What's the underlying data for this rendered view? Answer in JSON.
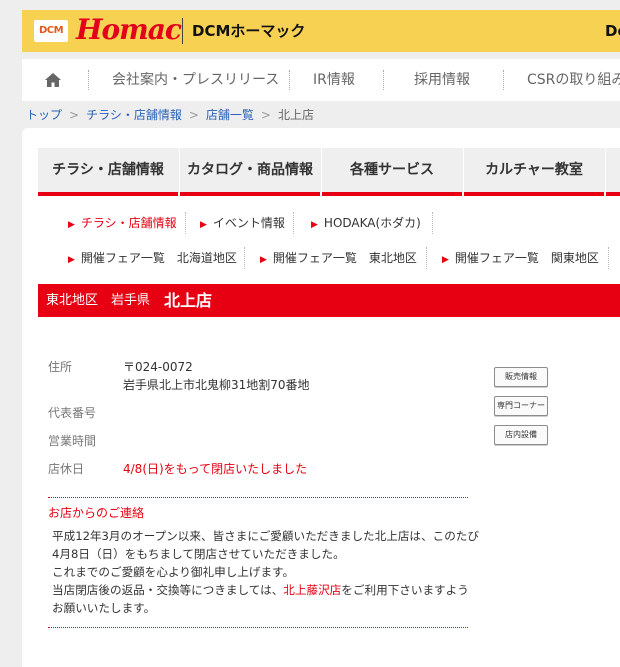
{
  "header": {
    "dcm_badge": "DCM",
    "brand": "Homac",
    "company": "DCMホーマック",
    "right_cut": "De"
  },
  "topnav": {
    "items": [
      "会社案内・プレスリリース",
      "IR情報",
      "採用情報",
      "CSRの取り組み"
    ]
  },
  "breadcrumb": {
    "items": [
      "トップ",
      "チラシ・店舗情報",
      "店舗一覧",
      "北上店"
    ],
    "separator": ">"
  },
  "global_nav": {
    "tabs": [
      "チラシ・店舗情報",
      "カタログ・商品情報",
      "各種サービス",
      "カルチャー教室"
    ]
  },
  "sub_nav": {
    "row1": [
      "チラシ・店舗情報",
      "イベント情報",
      "HODAKA(ホダカ)"
    ],
    "row2": [
      "開催フェア一覧　北海道地区",
      "開催フェア一覧　東北地区",
      "開催フェア一覧　関東地区"
    ]
  },
  "store": {
    "region": "東北地区　岩手県",
    "name": "北上店",
    "address_label": "住所",
    "postal": "〒024-0072",
    "address": "岩手県北上市北鬼柳31地割70番地",
    "phone_label": "代表番号",
    "phone": "",
    "hours_label": "営業時間",
    "hours": "",
    "closed_label": "店休日",
    "closed": "4/8(日)をもって閉店いたしました"
  },
  "side_buttons": [
    "販売情報",
    "専門コーナー",
    "店内設備"
  ],
  "notice": {
    "title": "お店からのご連絡",
    "line1": "平成12年3月のオープン以来、皆さまにご愛顧いただきました北上店は、このたび",
    "line2": "4月8日（日）をもちまして閉店させていただきました。",
    "line3": "これまでのご愛顧を心より御礼申し上げます。",
    "line4_before": "当店閉店後の返品・交換等につきましては、",
    "line4_link": "北上藤沢店",
    "line4_after": "をご利用下さいますよう",
    "line5": "お願いいたします。"
  },
  "colors": {
    "accent_red": "#e60012",
    "header_yellow": "#f7d152",
    "link_blue": "#2a62b9"
  },
  "icons": [
    "home-icon",
    "arrow-right-icon"
  ]
}
